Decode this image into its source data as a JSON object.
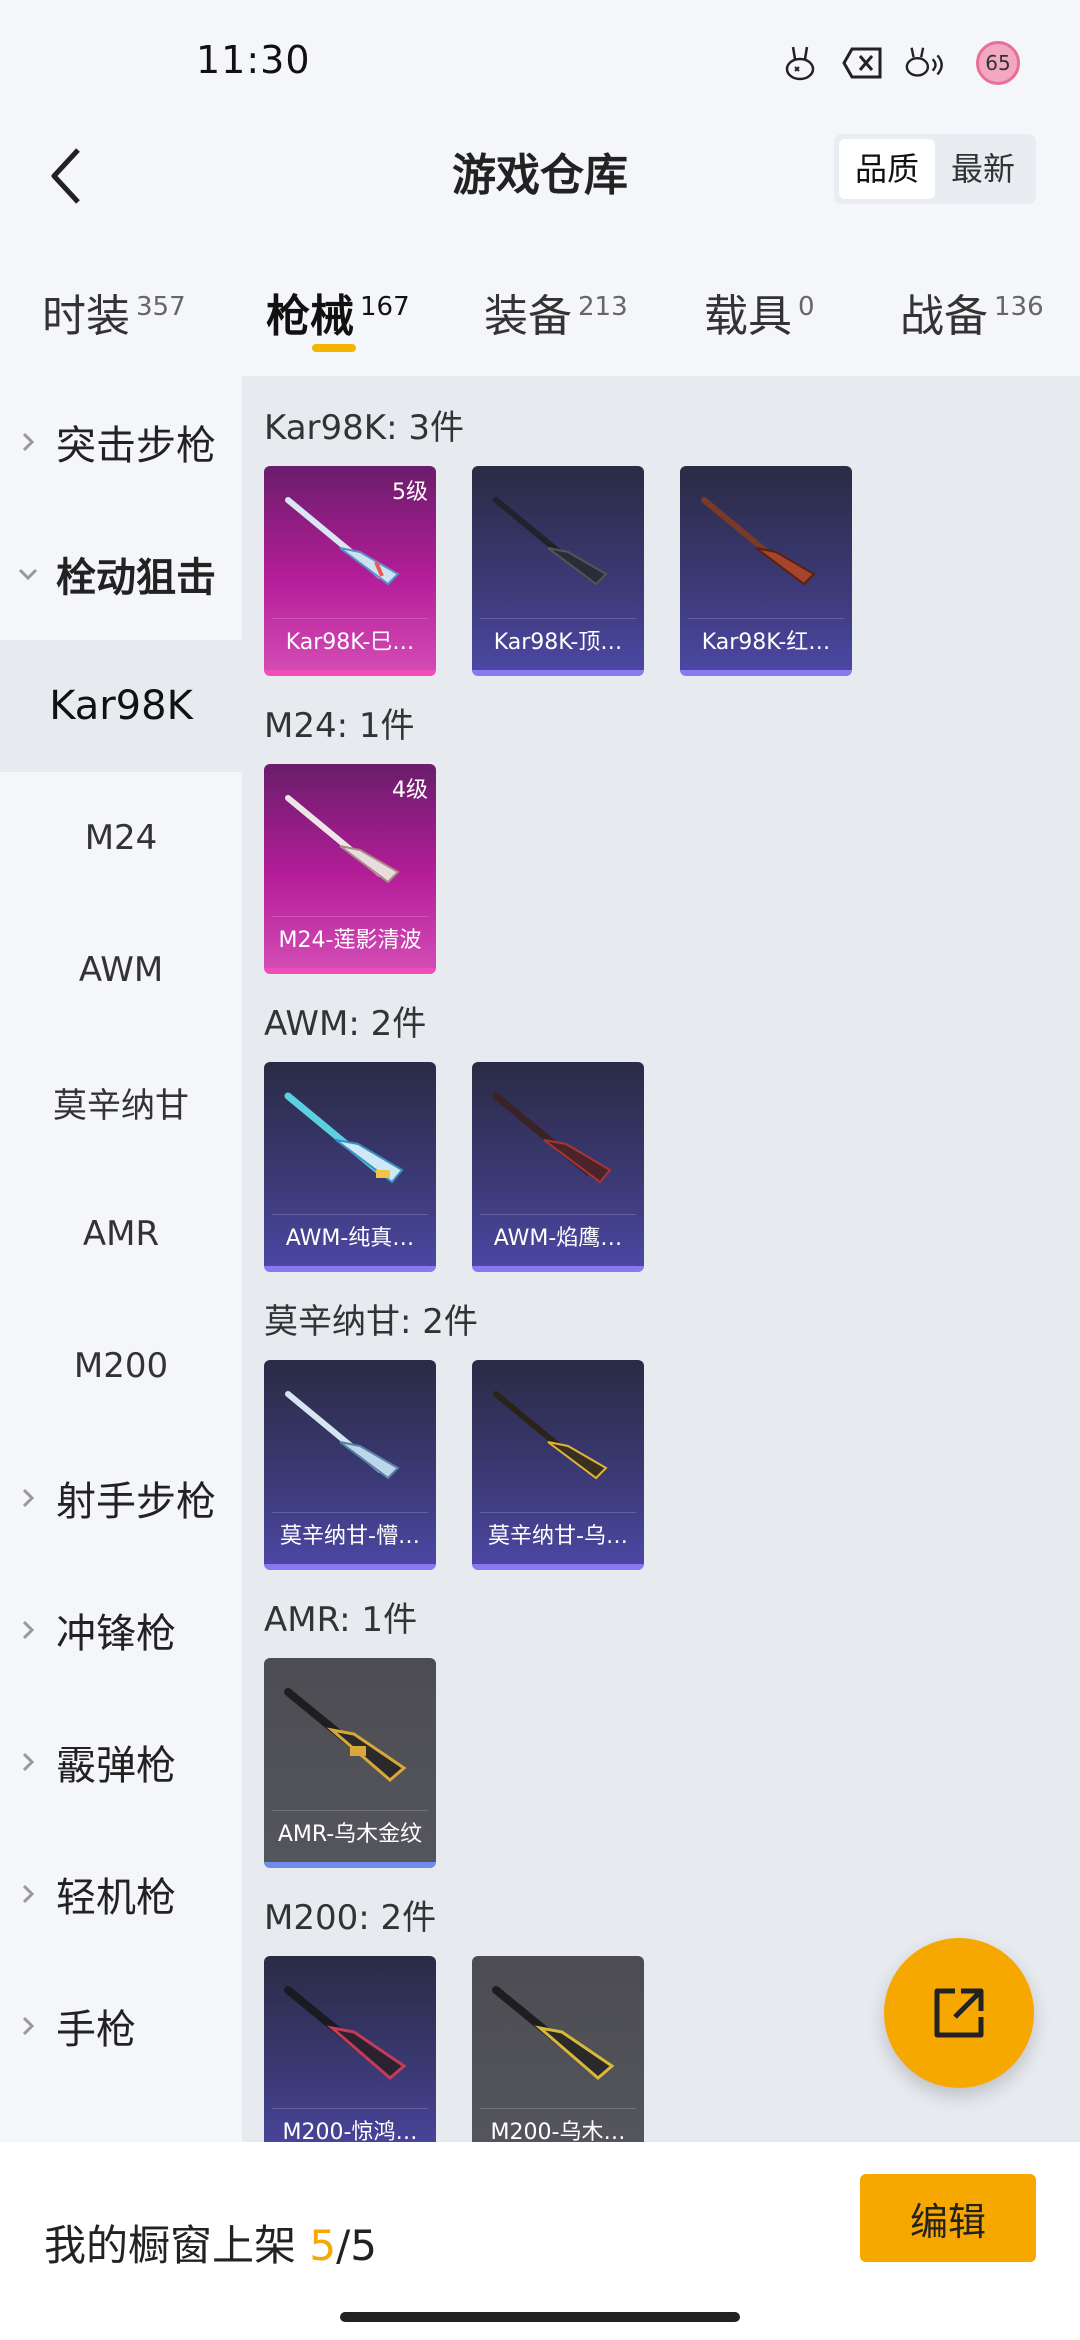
{
  "status_bar": {
    "time": "11:30",
    "battery": "65"
  },
  "header": {
    "title": "游戏仓库",
    "sort_options": [
      "品质",
      "最新"
    ],
    "active_sort": "品质"
  },
  "tabs": [
    {
      "label": "时装",
      "count": "357"
    },
    {
      "label": "枪械",
      "count": "167"
    },
    {
      "label": "装备",
      "count": "213"
    },
    {
      "label": "载具",
      "count": "0"
    },
    {
      "label": "战备",
      "count": "136"
    }
  ],
  "active_tab": "枪械",
  "sidebar": {
    "items": [
      {
        "label": "突击步枪"
      },
      {
        "label": "栓动狙击"
      },
      {
        "label": "Kar98K"
      },
      {
        "label": "M24"
      },
      {
        "label": "AWM"
      },
      {
        "label": "莫辛纳甘"
      },
      {
        "label": "AMR"
      },
      {
        "label": "M200"
      },
      {
        "label": "射手步枪"
      },
      {
        "label": "冲锋枪"
      },
      {
        "label": "霰弹枪"
      },
      {
        "label": "轻机枪"
      },
      {
        "label": "手枪"
      }
    ]
  },
  "groups": [
    {
      "title": "Kar98K: 3件",
      "items": [
        {
          "name": "Kar98K-巳…",
          "level": "5级",
          "tier": "pink"
        },
        {
          "name": "Kar98K-顶…",
          "tier": "purple"
        },
        {
          "name": "Kar98K-红…",
          "tier": "purple"
        }
      ]
    },
    {
      "title": "M24: 1件",
      "items": [
        {
          "name": "M24-莲影清波",
          "level": "4级",
          "tier": "pink"
        }
      ]
    },
    {
      "title": "AWM: 2件",
      "items": [
        {
          "name": "AWM-纯真…",
          "tier": "purple"
        },
        {
          "name": "AWM-焰鹰…",
          "tier": "purple"
        }
      ]
    },
    {
      "title": "莫辛纳甘: 2件",
      "items": [
        {
          "name": "莫辛纳甘-懵…",
          "tier": "purple"
        },
        {
          "name": "莫辛纳甘-乌…",
          "tier": "purple"
        }
      ]
    },
    {
      "title": "AMR: 1件",
      "items": [
        {
          "name": "AMR-乌木金纹",
          "tier": "gray"
        }
      ]
    },
    {
      "title": "M200: 2件",
      "items": [
        {
          "name": "M200-惊鸿…",
          "tier": "purple"
        },
        {
          "name": "M200-乌木…",
          "tier": "gray"
        }
      ]
    }
  ],
  "footer": {
    "shelf_label": "我的橱窗上架",
    "shelf_used": "5",
    "shelf_sep": "/",
    "shelf_total": "5",
    "edit_label": "编辑"
  },
  "colors": {
    "accent": "#f7a800",
    "tier_pink": "#b51d99",
    "tier_purple": "#3c3a77",
    "tier_gray": "#55555d"
  },
  "icons": {
    "back": "chevron-left-icon",
    "fab": "share-icon",
    "expand": "chevron-right-icon",
    "collapse": "chevron-down-icon"
  }
}
